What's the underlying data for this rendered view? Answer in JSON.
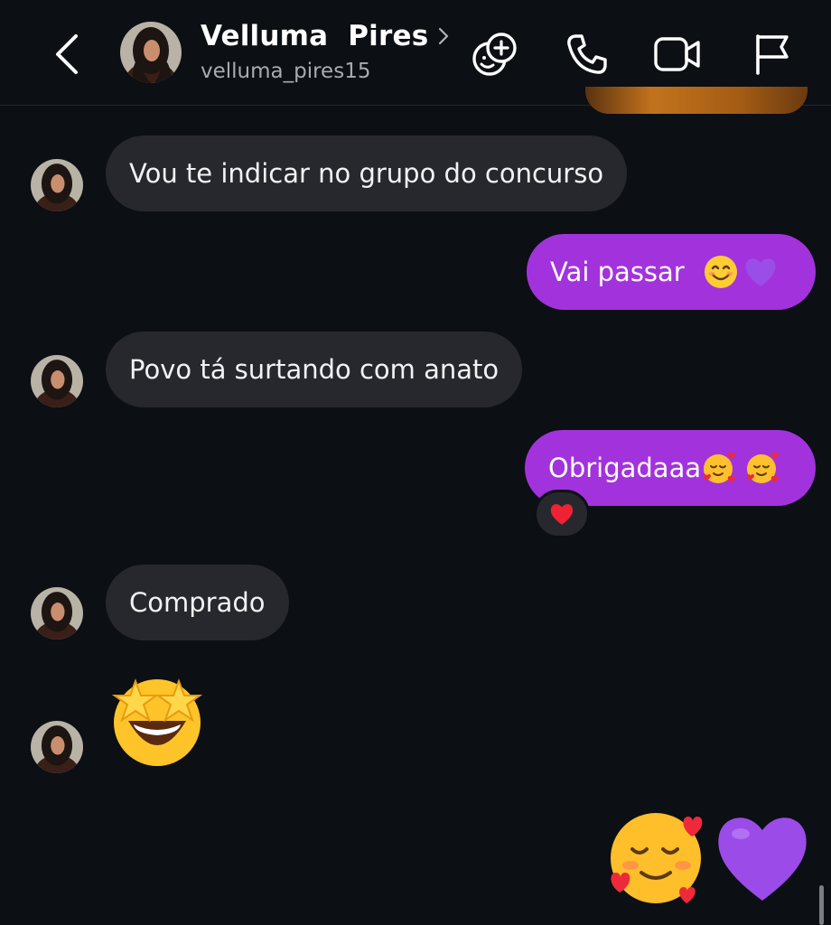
{
  "header": {
    "contact_name": "Velluma  Pires",
    "handle": "velluma_pires15"
  },
  "messages": [
    {
      "side": "in",
      "text": "Vou te indicar no grupo do concurso"
    },
    {
      "side": "out",
      "text": "Vai passar",
      "emojis": [
        "smiling-face-icon",
        "purple-heart-icon"
      ]
    },
    {
      "side": "in",
      "text": "Povo tá surtando com anato"
    },
    {
      "side": "out",
      "text": "Obrigadaaa",
      "emojis": [
        "smiling-face-hearts-icon",
        "smiling-face-hearts-icon"
      ],
      "reaction": "red-heart-icon"
    },
    {
      "side": "in",
      "text": "Comprado"
    },
    {
      "side": "in",
      "sticker": "star-struck-icon"
    },
    {
      "side": "out",
      "sticker": [
        "smiling-face-hearts-icon",
        "purple-heart-icon"
      ]
    }
  ],
  "colors": {
    "background": "#0c0f14",
    "incoming_bubble": "#26282d",
    "outgoing_bubble": "#a233dc"
  }
}
